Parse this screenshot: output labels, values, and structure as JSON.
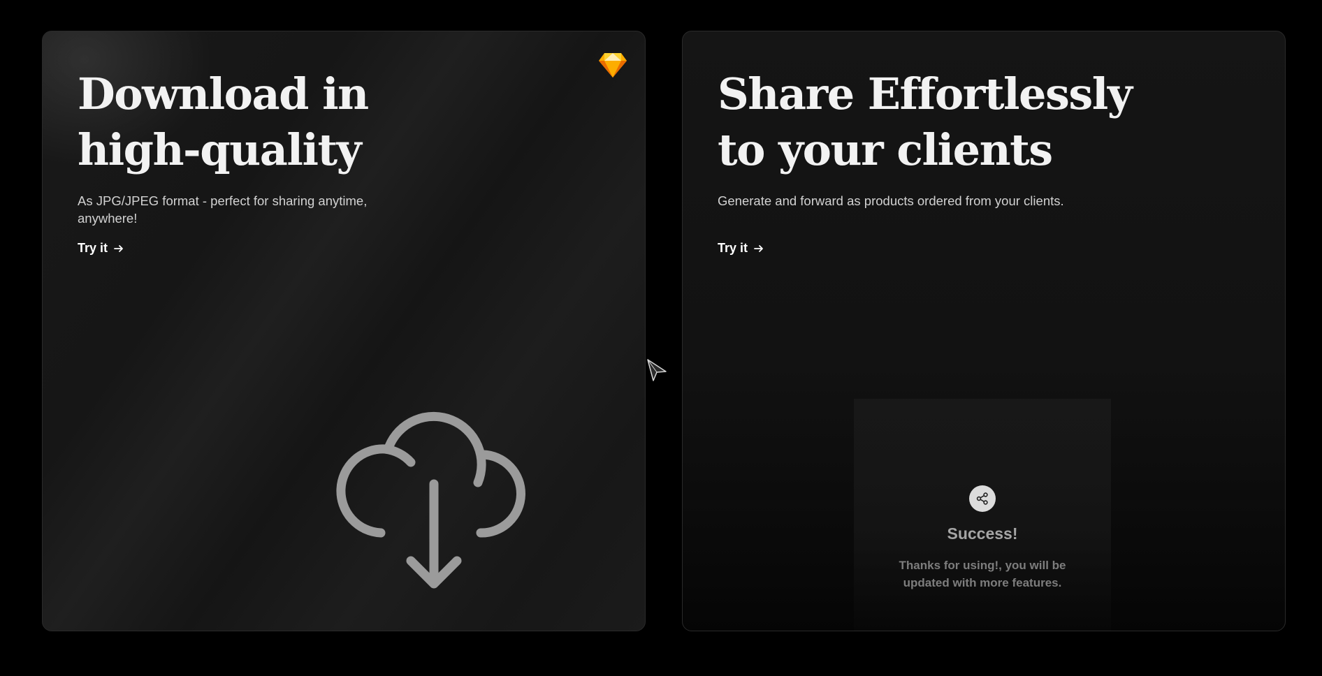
{
  "cards": [
    {
      "title_line1": "Download in",
      "title_line2": "high-quality",
      "description": "As JPG/JPEG format - perfect for sharing anytime, anywhere!",
      "cta": "Try it",
      "badge_icon": "sketch-gem-icon",
      "illustration_icon": "cloud-download-icon"
    },
    {
      "title_line1": "Share Effortlessly",
      "title_line2": "to your clients",
      "description": "Generate and forward as products ordered from your clients.",
      "cta": "Try it",
      "panel": {
        "icon": "share-icon",
        "title": "Success!",
        "message": "Thanks for using!, you will be updated with more features."
      }
    }
  ],
  "colors": {
    "background": "#000000",
    "card": "#161616",
    "title": "#f2f2f2",
    "gem_orange": "#f5a623"
  }
}
